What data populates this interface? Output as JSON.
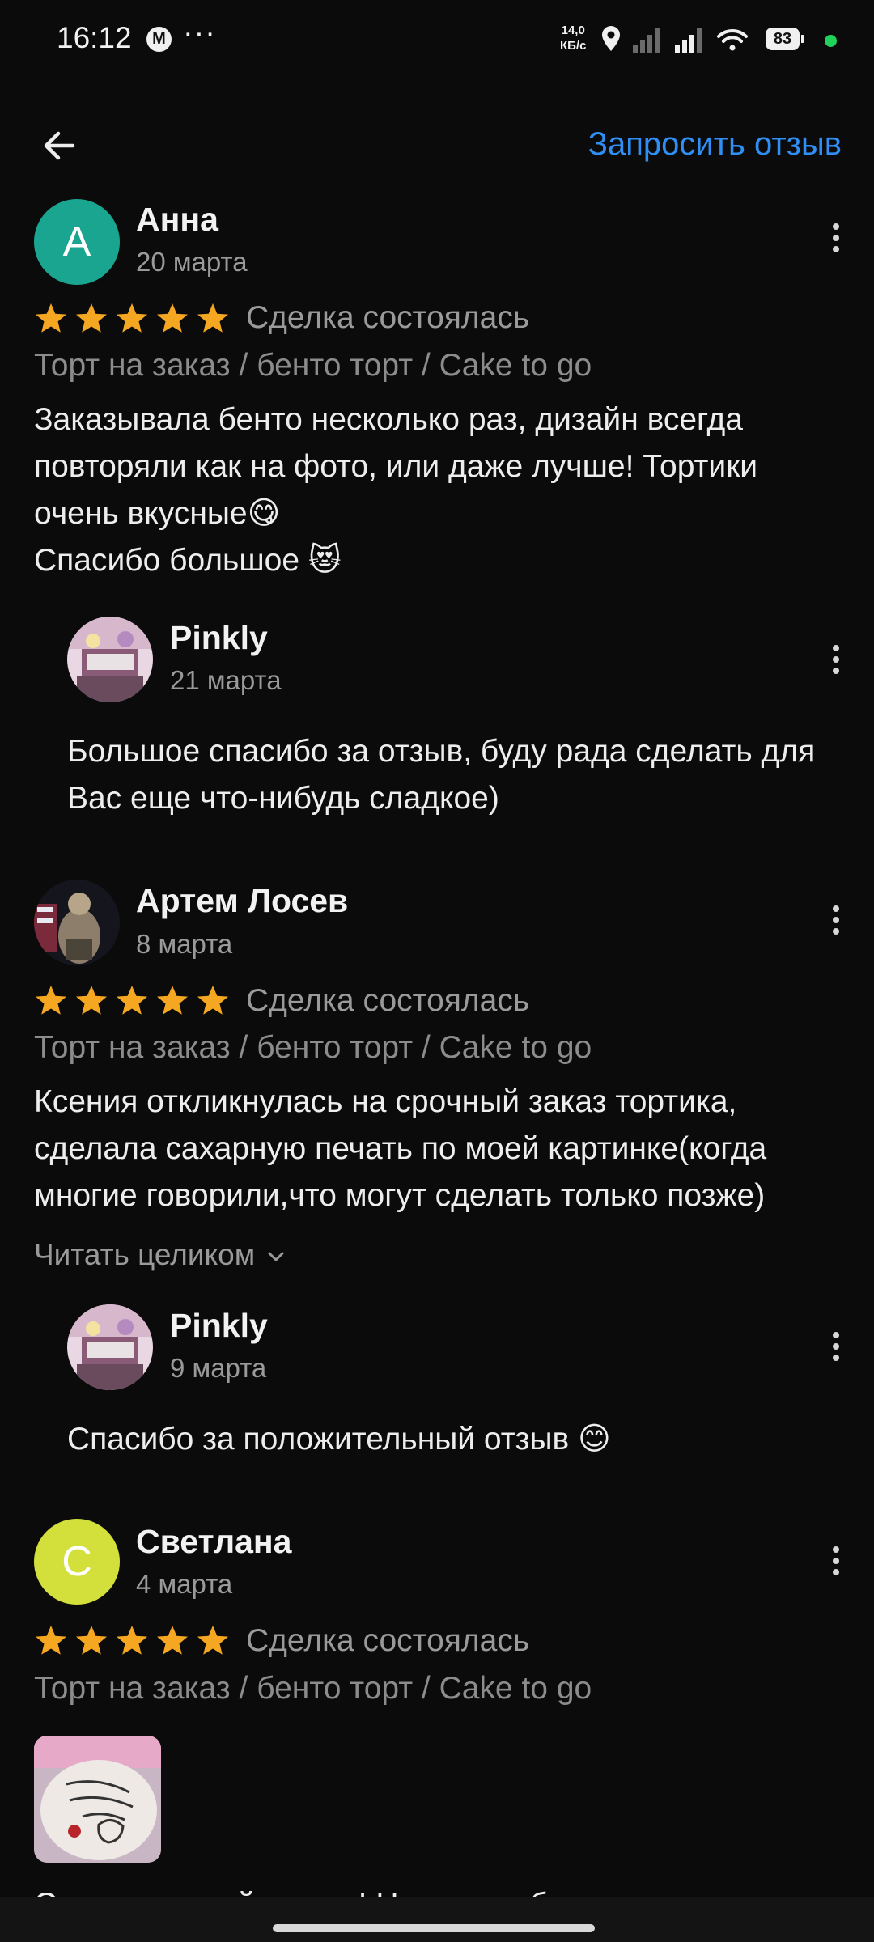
{
  "status_bar": {
    "time": "16:12",
    "mail_icon": "M",
    "more": "···",
    "speed_value": "14,0",
    "speed_unit": "КБ/с",
    "battery": "83"
  },
  "header": {
    "back_icon": "arrow-left-icon",
    "request_review": "Запросить отзыв"
  },
  "reviews": [
    {
      "avatar_letter": "А",
      "avatar_color": "#1aa591",
      "author": "Анна",
      "date": "20 марта",
      "rating": 5,
      "deal": "Сделка состоялась",
      "category": "Торт на заказ / бенто торт / Cake to go",
      "text": "Заказывала бенто несколько раз, дизайн всегда\nповторяли как на фото, или даже лучше! Тортики\nочень вкусные😋\nСпасибо большое 😻",
      "reply": {
        "author": "Pinkly",
        "date": "21 марта",
        "text": "Большое спасибо за отзыв, буду рада сделать для\nВас еще что-нибудь сладкое)"
      }
    },
    {
      "author": "Артем Лосев",
      "date": "8 марта",
      "rating": 5,
      "deal": "Сделка состоялась",
      "category": "Торт на заказ / бенто торт / Cake to go",
      "text": "Ксения откликнулась на срочный заказ тортика,\nсделала сахарную печать по моей картинке(когда\nмногие говорили,что могут сделать только позже)",
      "read_more": "Читать целиком",
      "reply": {
        "author": "Pinkly",
        "date": "9 марта",
        "text": "Спасибо за положительный отзыв 😊"
      }
    },
    {
      "avatar_letter": "С",
      "avatar_color": "#d3df3b",
      "author": "Светлана",
      "date": "4 марта",
      "rating": 5,
      "deal": "Сделка состоялась",
      "category": "Торт на заказ / бенто торт / Cake to go",
      "text_partial": "Очень вкусный тортик! Нуы спасибо за"
    }
  ],
  "colors": {
    "accent": "#2f8ff5",
    "star": "#f6a722",
    "background": "#0b0b0b"
  }
}
